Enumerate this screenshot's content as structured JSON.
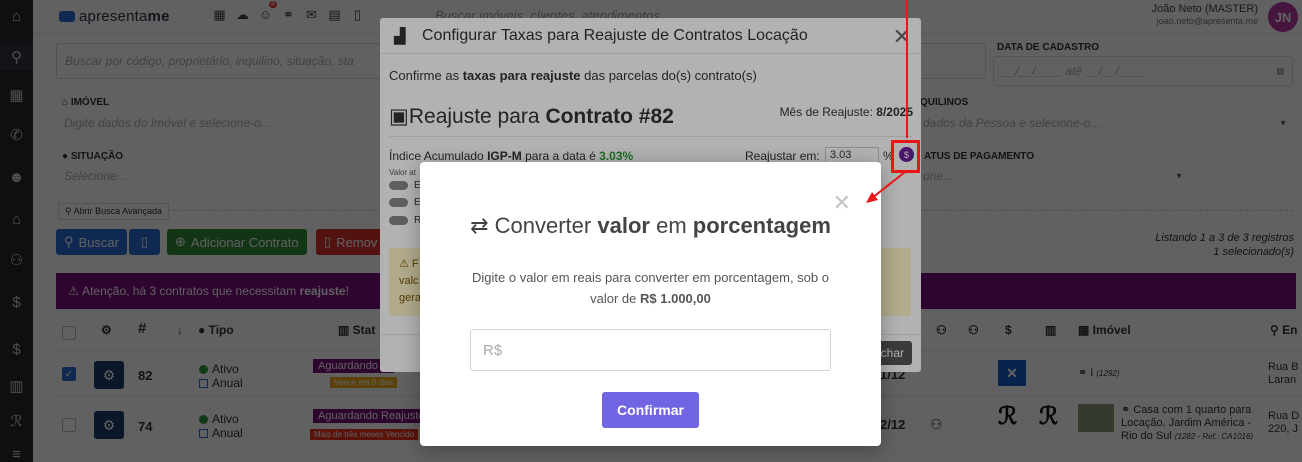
{
  "header": {
    "logo_text": "apresenta",
    "logo_suffix": "me",
    "search_placeholder": "Buscar imóveis, clientes, atendimentos",
    "user_name": "João Neto (MASTER)",
    "user_email": "joao.neto@apresenta.me",
    "avatar_initials": "JN",
    "notification_count": "8"
  },
  "filters": {
    "search_placeholder": "Buscar por código, proprietário, inquilino, situação, sta",
    "data_cadastro_label": "DATA DE CADASTRO",
    "data_cadastro_value": "__/__/____",
    "data_ate": "até",
    "data_cadastro_value2": "__/__/____",
    "imovel_label": "IMÓVEL",
    "imovel_placeholder": "Digite dados do Imóvel e selecione-o...",
    "inquilinos_label": "QUILINOS",
    "inquilinos_placeholder": "dados da Pessoa e selecione-o...",
    "situacao_label": "SITUAÇÃO",
    "situacao_placeholder": "Selecione...",
    "pagamento_label": "ATUS DE PAGAMENTO",
    "pagamento_placeholder": "one...",
    "advanced_search": "Abrir Busca Avançada"
  },
  "actions": {
    "buscar": "Buscar",
    "adicionar": "Adicionar Contrato",
    "remover": "Remov"
  },
  "listing": {
    "line1": "Listando 1 a 3 de 3 registros",
    "line2": "1 selecionado(s)"
  },
  "alert": {
    "prefix": "Atenção, há 3 contratos que necessitam",
    "bold": "reajuste",
    "suffix": "!"
  },
  "table": {
    "col_hash": "#",
    "col_tipo": "Tipo",
    "col_status": "Stat",
    "col_imovel": "Imóvel",
    "col_end": "En",
    "rows": [
      {
        "id": "82",
        "status": "Ativo",
        "freq": "Anual",
        "badge1": "Aguardando R",
        "badge2": "Vence em 9 dias",
        "due": "1/12",
        "imovel": "(1292)",
        "end1": "Rua B",
        "end2": "Laran"
      },
      {
        "id": "74",
        "status": "Ativo",
        "freq": "Anual",
        "badge1": "Aguardando Reajuste",
        "badge2": "Mais de três meses Vencido",
        "due": "2/12",
        "imovel1": "Casa com 1 quarto para",
        "imovel2": "Locação, Jardim América -",
        "imovel3": "Rio do Sul",
        "imovel_ref": "(1282 - Ref.: CA1016)",
        "end1": "Rua D",
        "end2": "220, J"
      }
    ]
  },
  "modal_taxas": {
    "title": "Configurar Taxas para Reajuste de Contratos Locação",
    "confirm_prefix": "Confirme as",
    "confirm_bold": "taxas para reajuste",
    "confirm_suffix": "das parcelas do(s) contrato(s)",
    "reajuste_prefix": "Reajuste para",
    "reajuste_bold": "Contrato #82",
    "mes_label": "Mês de Reajuste:",
    "mes_value": "8/2025",
    "indice_prefix": "Índice Acumulado",
    "indice_bold": "IGP-M",
    "indice_mid": "para a data é",
    "indice_value": "3.03%",
    "reajustar_label": "Reajustar em:",
    "reajustar_value": "3.03",
    "pct": "%",
    "valor_label": "Valor at",
    "toggles": [
      "E",
      "E",
      "R"
    ],
    "warn_line1": "F",
    "warn_line2": "valc",
    "warn_line3": "gera",
    "fechar": "char"
  },
  "modal_converter": {
    "title_prefix": "Converter",
    "title_b1": "valor",
    "title_mid": "em",
    "title_b2": "porcentagem",
    "desc_prefix": "Digite o valor em reais para converter em porcentagem, sob o valor de",
    "desc_bold": "R$ 1.000,00",
    "input_placeholder": "R$",
    "confirm_button": "Confirmar"
  },
  "colors": {
    "rail": "#23282d",
    "purple": "#7a0f78",
    "confirm": "#7064e3",
    "annotation": "#e81616",
    "success": "#2e9b3a"
  }
}
